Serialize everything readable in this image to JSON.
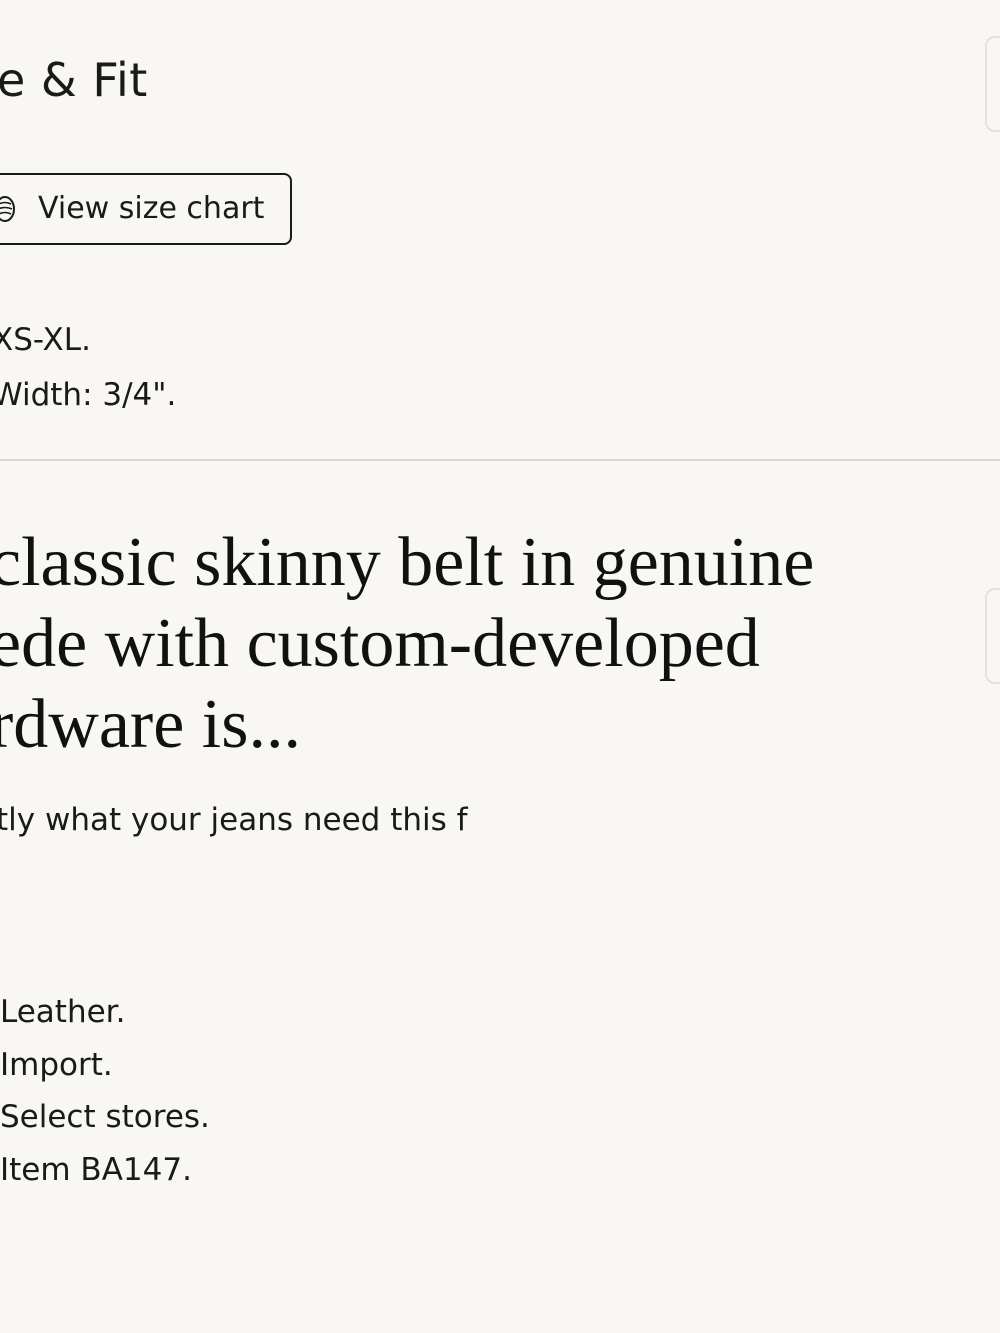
{
  "size_fit": {
    "title": "e & Fit",
    "size_chart_button": {
      "label": "View size chart",
      "icon": "size-chart-icon"
    },
    "lines": [
      "XS-XL.",
      "Width: 3/4\"."
    ]
  },
  "description": {
    "headline_lines": [
      "classic skinny belt in genuine",
      "ede with custom-developed",
      "rdware is..."
    ],
    "teaser": "tly what your jeans need this f"
  },
  "details": [
    "Leather.",
    "Import.",
    "Select stores.",
    "Item BA147."
  ],
  "colors": {
    "background": "#f8f7f3",
    "text": "#1a1a1a",
    "divider": "#d9d8d3"
  }
}
